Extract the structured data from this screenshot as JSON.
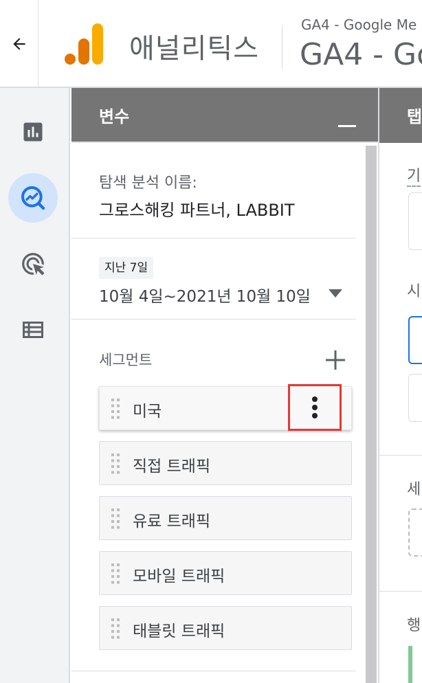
{
  "header": {
    "back_icon": "arrow-left-icon",
    "app_name": "애널리틱스",
    "property_small": "GA4 - Google Me",
    "property_large": "GA4 - Go"
  },
  "leftnav": {
    "items": [
      {
        "icon": "bar-chart-icon"
      },
      {
        "icon": "explore-icon",
        "active": true
      },
      {
        "icon": "ads-click-icon"
      },
      {
        "icon": "list-icon"
      }
    ]
  },
  "variables": {
    "title": "변수",
    "name_label": "탐색 분석 이름:",
    "name_value": "그로스해킹 파트너, LABBIT",
    "date_chip": "지난 7일",
    "date_range": "10월 4일~2021년 10월 10일",
    "segments_label": "세그먼트",
    "segments": [
      {
        "label": "미국"
      },
      {
        "label": "직접 트래픽"
      },
      {
        "label": "유료 트래픽"
      },
      {
        "label": "모바일 트래픽"
      },
      {
        "label": "태블릿 트래픽"
      }
    ]
  },
  "tab_settings": {
    "title": "탭",
    "frag1": "기",
    "frag2": "시",
    "frag3": "세",
    "frag4": "행"
  },
  "colors": {
    "panel_header": "#757575",
    "accent_blue": "#1a73e8",
    "highlight_red": "#e53935",
    "logo_orange": "#e37400",
    "logo_yellow": "#f9ab00"
  }
}
